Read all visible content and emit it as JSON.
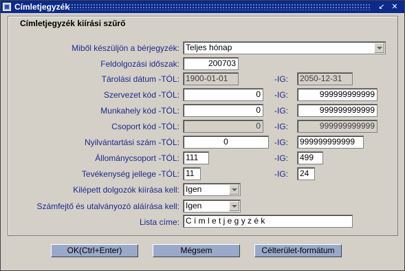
{
  "window": {
    "title": "Címletjegyzék"
  },
  "panel": {
    "title": "Címletjegyzék kiírási szűrő"
  },
  "form": {
    "mibol": {
      "label": "Miből készüljön a bérjegyzék:",
      "value": "Teljes hónap"
    },
    "idoszak": {
      "label": "Feldolgozási időszak:",
      "value": "200703"
    },
    "tarolasi": {
      "label": "Tárolási dátum -TÓL:",
      "from": "1900-01-01",
      "to_label": "-IG:",
      "to": "2050-12-31"
    },
    "szervezet": {
      "label": "Szervezet kód -TÓL:",
      "from": "0",
      "to_label": "-IG:",
      "to": "999999999999"
    },
    "munkahely": {
      "label": "Munkahely kód -TÓL:",
      "from": "0",
      "to_label": "-IG:",
      "to": "999999999999"
    },
    "csoport": {
      "label": "Csoport kód -TÓL:",
      "from": "0",
      "to_label": "-IG:",
      "to": "999999999999"
    },
    "nyilvantartasi": {
      "label": "Nyilvántartási szám -TÓL:",
      "from": "0",
      "to_label": "-IG:",
      "to": "999999999999"
    },
    "allomanycsoport": {
      "label": "Állománycsoport -TÓL:",
      "from": "111",
      "to_label": "-IG:",
      "to": "499"
    },
    "tevekenyseg": {
      "label": "Tevékenység jellege -TÓL:",
      "from": "11",
      "to_label": "-IG:",
      "to": "24"
    },
    "kilepett": {
      "label": "Kilépett dolgozók kiírása kell:",
      "value": "Igen"
    },
    "szamfejto": {
      "label": "Számfejtő és utalványozó aláírása kell:",
      "value": "Igen"
    },
    "lista": {
      "label": "Lista címe:",
      "value": "C í m l e t j e g y z é k"
    }
  },
  "buttons": {
    "ok": "OK(Ctrl+Enter)",
    "cancel": "Mégsem",
    "format": "Célterület-formátum"
  }
}
